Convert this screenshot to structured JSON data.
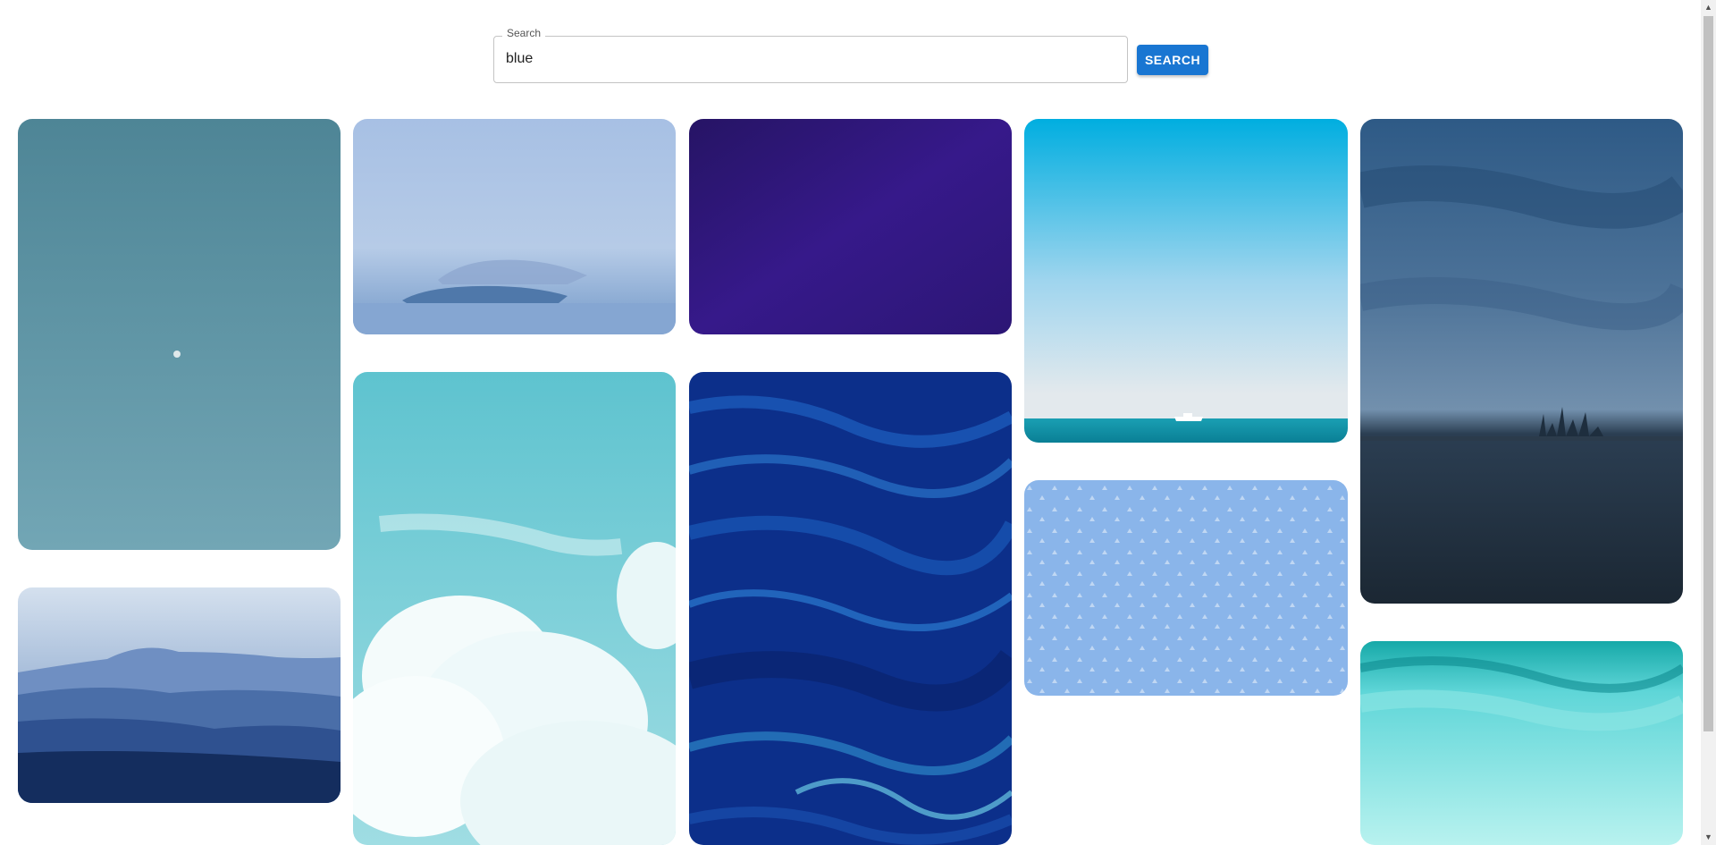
{
  "search": {
    "legend": "Search",
    "value": "blue",
    "button_label": "SEARCH"
  },
  "gallery": {
    "tiles": [
      {
        "subject": "teal sky with tiny moon",
        "colors": [
          "#4e8596",
          "#6b9fae"
        ]
      },
      {
        "subject": "misty blue mountain ridges",
        "colors": [
          "#c9d7e8",
          "#0f2a52"
        ]
      },
      {
        "subject": "hazy islands over calm sea",
        "colors": [
          "#a9c3e6",
          "#6f93c2"
        ]
      },
      {
        "subject": "light teal sky with white clouds",
        "colors": [
          "#5ec7d1",
          "#b8e8ea"
        ]
      },
      {
        "subject": "deep purple fabric",
        "colors": [
          "#2a1770",
          "#3a1f8c"
        ]
      },
      {
        "subject": "dark blue marbled fluid art",
        "colors": [
          "#0b2f8a",
          "#113ea6"
        ]
      },
      {
        "subject": "bright sky over turquoise sea with boat",
        "colors": [
          "#00b0e0",
          "#e4eef3"
        ]
      },
      {
        "subject": "light blue patterned fabric",
        "colors": [
          "#86b3e8",
          "#9dc3ef"
        ]
      },
      {
        "subject": "stormy sky over city skyline and dark water",
        "colors": [
          "#2a5178",
          "#1a2735"
        ]
      },
      {
        "subject": "aqua watercolor wash",
        "colors": [
          "#5fd6d8",
          "#aef0ee"
        ]
      }
    ]
  }
}
